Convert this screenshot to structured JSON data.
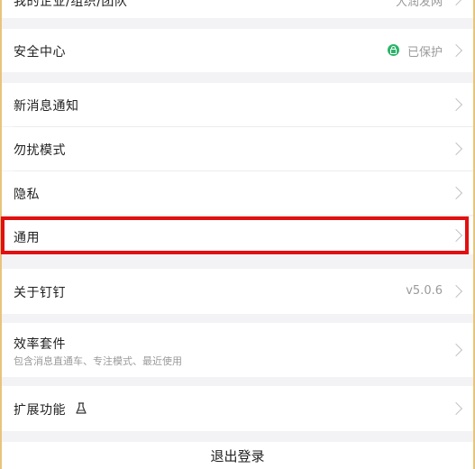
{
  "settings": {
    "top_cut": {
      "label": "我的企业/组织/团队",
      "value": "大润发网"
    },
    "security": {
      "label": "安全中心",
      "status": "已保护"
    },
    "group2": [
      {
        "label": "新消息通知"
      },
      {
        "label": "勿扰模式"
      },
      {
        "label": "隐私"
      },
      {
        "label": "通用"
      }
    ],
    "about": {
      "label": "关于钉钉",
      "version": "v5.0.6"
    },
    "efficiency": {
      "label": "效率套件",
      "subtitle": "包含消息直通车、专注模式、最近使用"
    },
    "extensions": {
      "label": "扩展功能"
    },
    "logout": {
      "label": "退出登录"
    }
  },
  "colors": {
    "accent_highlight": "#e21010",
    "secure_green": "#2db46a"
  },
  "icons": [
    "shield-check-icon",
    "chevron-right-icon",
    "flask-icon"
  ]
}
